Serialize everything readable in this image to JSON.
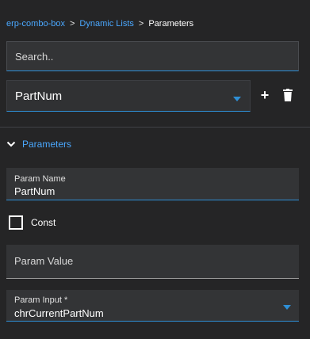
{
  "breadcrumb": {
    "items": [
      "erp-combo-box",
      "Dynamic Lists"
    ],
    "separator": ">",
    "current": "Parameters"
  },
  "search": {
    "placeholder": "Search..",
    "value": ""
  },
  "list_select": {
    "value": "PartNum"
  },
  "toolbar": {
    "add_label": "+",
    "delete_icon": "trash-icon"
  },
  "section": {
    "title": "Parameters",
    "expanded": true
  },
  "fields": {
    "param_name": {
      "label": "Param Name",
      "value": "PartNum"
    },
    "const": {
      "label": "Const",
      "checked": false
    },
    "param_value": {
      "label": "Param Value",
      "value": ""
    },
    "param_input": {
      "label": "Param Input *",
      "value": "chrCurrentPartNum"
    }
  },
  "colors": {
    "background": "#252526",
    "link": "#4aa8ff",
    "accent": "#2e8fd6",
    "field_bg": "#333436"
  }
}
